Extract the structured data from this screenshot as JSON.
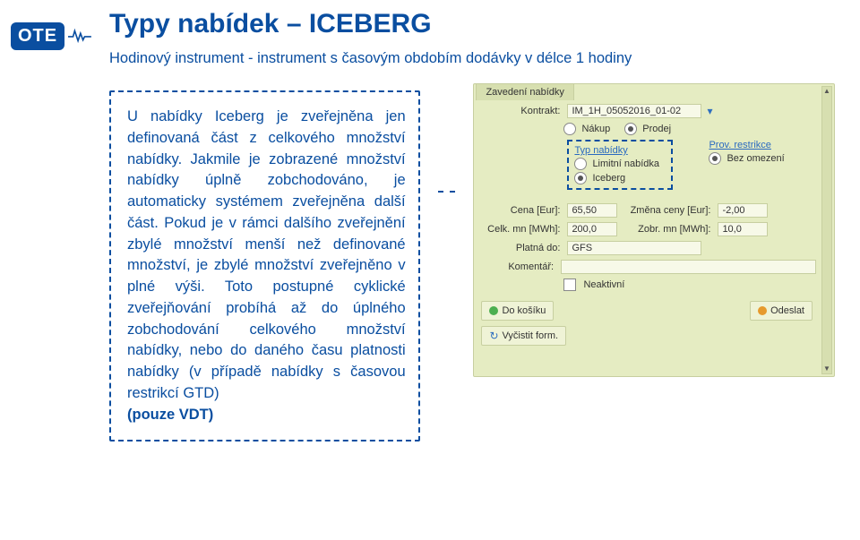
{
  "logo": {
    "text": "OTE"
  },
  "heading": "Typy nabídek – ICEBERG",
  "subheading": "Hodinový instrument - instrument s časovým obdobím dodávky v délce 1 hodiny",
  "callout": {
    "p1": "U nabídky Iceberg je zveřejněna jen definovaná část z celkového množství nabídky. Jakmile je zobrazené množství nabídky úplně zobchodováno, je automaticky systémem zveřejněna další část. Pokud je v rámci dalšího zveřejnění zbylé množství menší než definované množství, je zbylé množství zveřejněno v plné výši. Toto postupné cyklické zveřejňování probíhá až do úplného zobchodování celkového množství nabídky, nebo do daného času platnosti nabídky (v případě nabídky s časovou restrikcí GTD)",
    "p2": "(pouze VDT)"
  },
  "form": {
    "tab": "Zavedení nabídky",
    "kontrakt_label": "Kontrakt:",
    "kontrakt_value": "IM_1H_05052016_01-02",
    "nakup": "Nákup",
    "prodej": "Prodej",
    "prov_restrikce": "Prov. restrikce",
    "bez_omezeni": "Bez omezení",
    "typ_nabidky": "Typ nabídky",
    "limitni": "Limitní nabídka",
    "iceberg": "Iceberg",
    "cena_label": "Cena [Eur]:",
    "cena_value": "65,50",
    "zmena_label": "Změna ceny [Eur]:",
    "zmena_value": "-2,00",
    "celk_label": "Celk. mn [MWh]:",
    "celk_value": "200,0",
    "zobr_label": "Zobr. mn [MWh]:",
    "zobr_value": "10,0",
    "platna_label": "Platná do:",
    "platna_value": "GFS",
    "komentar_label": "Komentář:",
    "neaktivni": "Neaktivní",
    "btn_kosik": "Do košíku",
    "btn_odeslat": "Odeslat",
    "btn_vycistit": "Vyčistit form."
  }
}
